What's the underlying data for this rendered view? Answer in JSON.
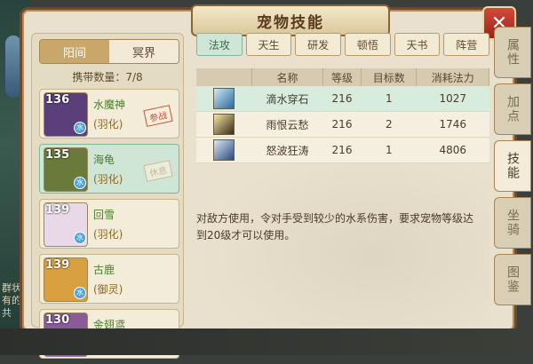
{
  "window": {
    "title": "宠物技能",
    "close_label": "✕"
  },
  "realm_tabs": [
    "阳间",
    "冥界"
  ],
  "realm_active": 0,
  "capacity": "携带数量：7/8",
  "pets": [
    {
      "level": "136",
      "name": "水魔神",
      "form": "(羽化)",
      "badge": "参战",
      "element": "水",
      "selected": false,
      "badge_dim": false
    },
    {
      "level": "135",
      "name": "海龟",
      "form": "(羽化)",
      "badge": "休息",
      "element": "水",
      "selected": true,
      "badge_dim": true
    },
    {
      "level": "139",
      "name": "回雪",
      "form": "(羽化)",
      "badge": "",
      "element": "水",
      "selected": false,
      "badge_dim": false
    },
    {
      "level": "139",
      "name": "古鹿",
      "form": "(御灵)",
      "badge": "",
      "element": "水",
      "selected": false,
      "badge_dim": false
    },
    {
      "level": "130",
      "name": "金翅鸢",
      "form": "(点化)",
      "badge": "",
      "element": "水",
      "selected": false,
      "badge_dim": false
    }
  ],
  "skill_tabs": [
    "法攻",
    "天生",
    "研发",
    "顿悟",
    "天书",
    "阵营"
  ],
  "skill_tab_active": 0,
  "table_headers": [
    "名称",
    "等级",
    "目标数",
    "消耗法力"
  ],
  "skills": [
    {
      "name": "滴水穿石",
      "level": "216",
      "targets": "1",
      "mana": "1027",
      "selected": true
    },
    {
      "name": "雨恨云愁",
      "level": "216",
      "targets": "2",
      "mana": "1746",
      "selected": false
    },
    {
      "name": "怒波狂涛",
      "level": "216",
      "targets": "1",
      "mana": "4806",
      "selected": false
    }
  ],
  "description": "对敌方使用，令对手受到较少的水系伤害，要求宠物等级达到20级才可以使用。",
  "side_tabs": [
    "属性",
    "加点",
    "技能",
    "坐骑",
    "图鉴"
  ],
  "side_tab_active": 2,
  "bg_chat": "群状有的共"
}
